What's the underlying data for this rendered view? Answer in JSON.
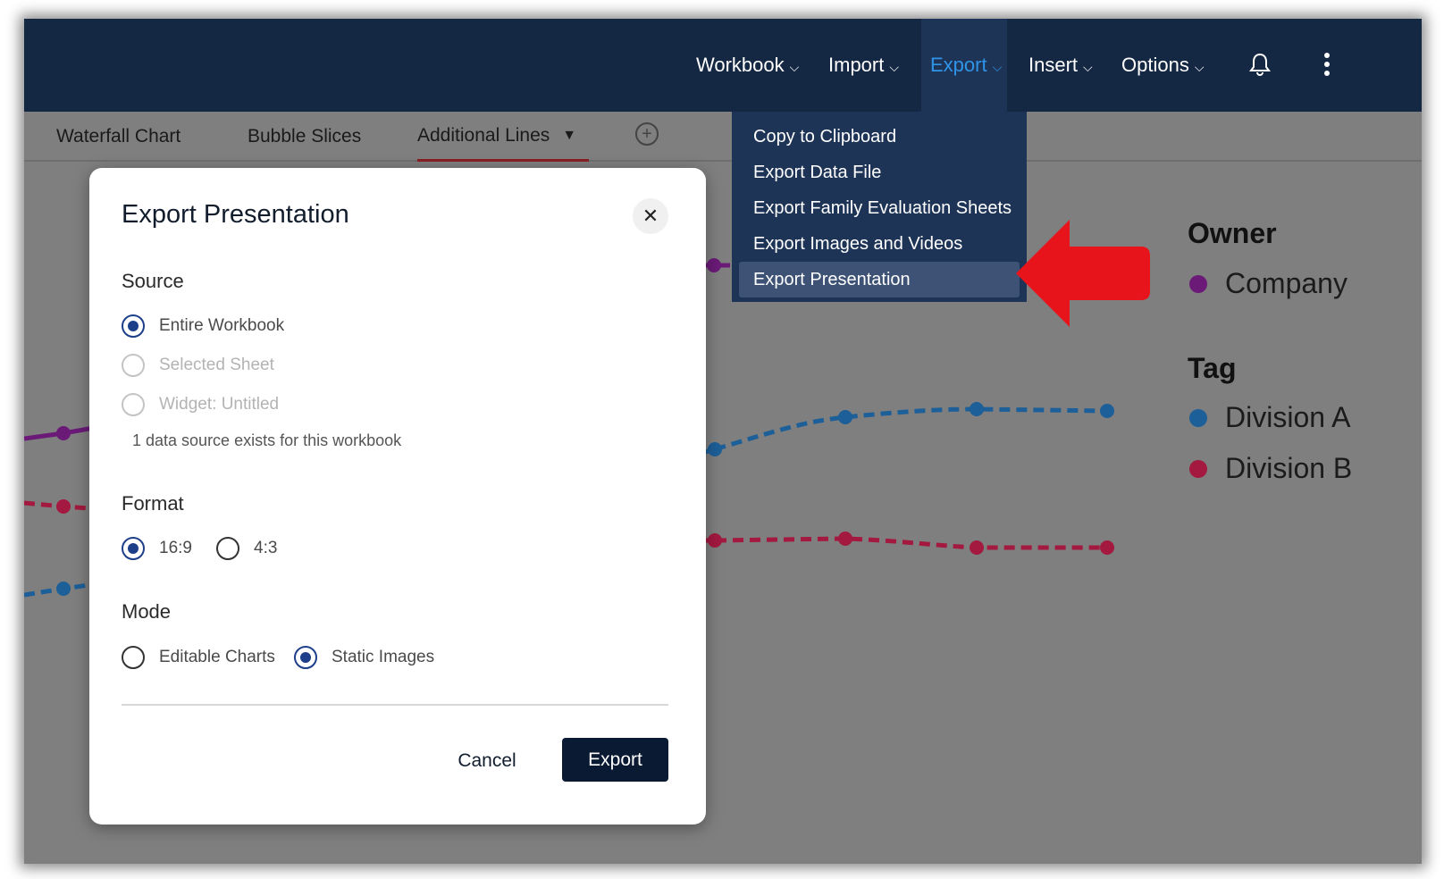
{
  "nav": {
    "items": [
      {
        "label": "Workbook"
      },
      {
        "label": "Import"
      },
      {
        "label": "Export"
      },
      {
        "label": "Insert"
      },
      {
        "label": "Options"
      }
    ],
    "chevron": "⌵"
  },
  "tabs": [
    {
      "label": "Waterfall Chart"
    },
    {
      "label": "Bubble Slices"
    },
    {
      "label": "Additional Lines"
    }
  ],
  "add_tab_symbol": "+",
  "export_menu": {
    "items": [
      {
        "label": "Copy to Clipboard"
      },
      {
        "label": "Export Data File"
      },
      {
        "label": "Export Family Evaluation Sheets"
      },
      {
        "label": "Export Images and Videos"
      },
      {
        "label": "Export Presentation"
      }
    ],
    "selected": "Export Presentation"
  },
  "legend": {
    "owner_title": "Owner",
    "owner_items": [
      {
        "label": "Company",
        "color": "#6b1a78"
      }
    ],
    "tag_title": "Tag",
    "tag_items": [
      {
        "label": "Division A",
        "color": "#1d5f98"
      },
      {
        "label": "Division B",
        "color": "#a3193f"
      }
    ]
  },
  "modal": {
    "title": "Export Presentation",
    "close_symbol": "✕",
    "source": {
      "label": "Source",
      "options": [
        {
          "label": "Entire Workbook",
          "checked": true,
          "disabled": false
        },
        {
          "label": "Selected Sheet",
          "checked": false,
          "disabled": true
        },
        {
          "label": "Widget: Untitled",
          "checked": false,
          "disabled": true
        }
      ],
      "hint": "1 data source exists for this workbook"
    },
    "format": {
      "label": "Format",
      "options": [
        {
          "label": "16:9",
          "checked": true
        },
        {
          "label": "4:3",
          "checked": false
        }
      ]
    },
    "mode": {
      "label": "Mode",
      "options": [
        {
          "label": "Editable Charts",
          "checked": false
        },
        {
          "label": "Static Images",
          "checked": true
        }
      ]
    },
    "cancel_label": "Cancel",
    "export_label": "Export"
  },
  "colors": {
    "nav_bg": "#152843",
    "menu_bg": "#1e3457",
    "accent": "#2f95e8",
    "arrow": "#e8141c",
    "primary_button": "#0b1a33"
  }
}
